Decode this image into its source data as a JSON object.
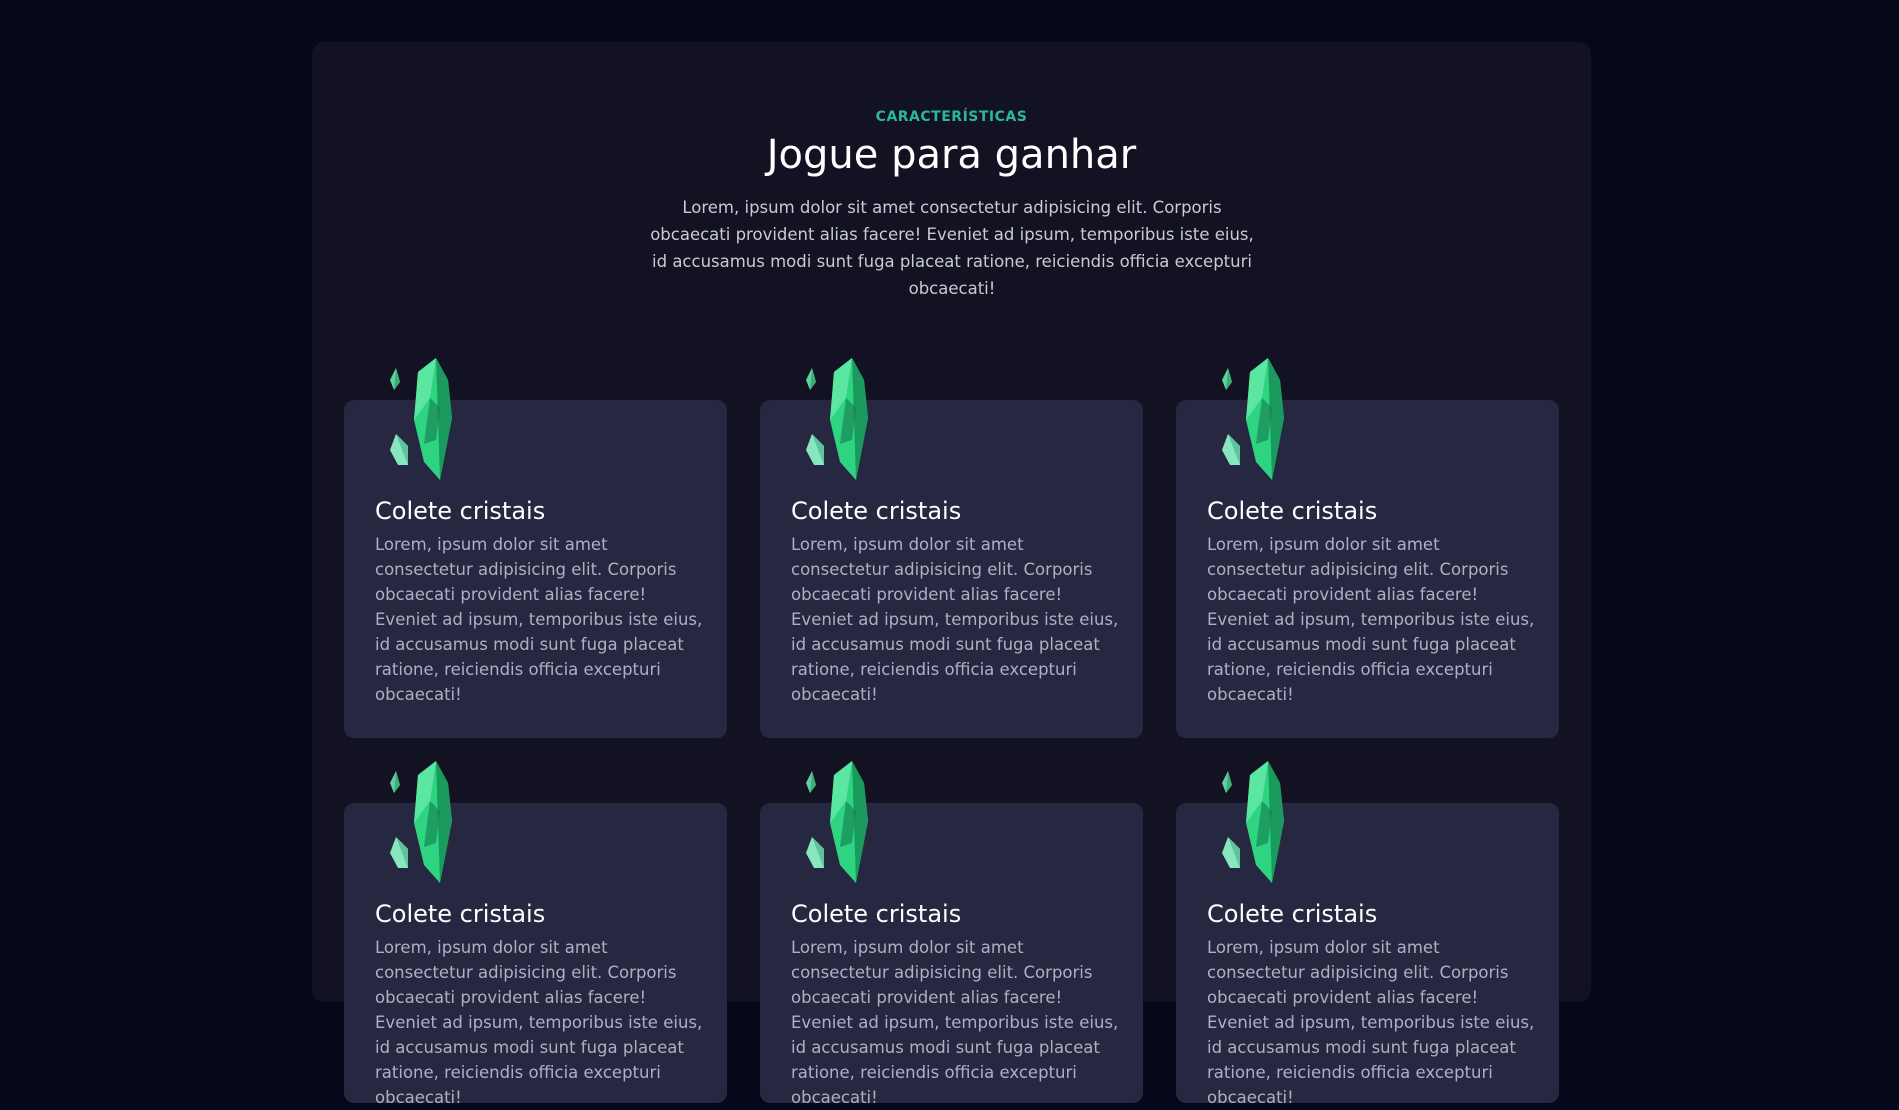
{
  "section": {
    "eyebrow": "CARACTERÍSTICAS",
    "title": "Jogue para ganhar",
    "intro": "Lorem, ipsum dolor sit amet consectetur adipisicing elit. Corporis obcaecati provident alias facere! Eveniet ad ipsum, temporibus iste eius, id accusamus modi sunt fuga placeat ratione, reiciendis officia excepturi obcaecati!"
  },
  "features": [
    {
      "title": "Colete cristais",
      "text": "Lorem, ipsum dolor sit amet consectetur adipisicing elit. Corporis obcaecati provident alias facere! Eveniet ad ipsum, temporibus iste eius, id accusamus modi sunt fuga placeat ratione, reiciendis officia excepturi obcaecati!",
      "icon": "crystal-icon"
    },
    {
      "title": "Colete cristais",
      "text": "Lorem, ipsum dolor sit amet consectetur adipisicing elit. Corporis obcaecati provident alias facere! Eveniet ad ipsum, temporibus iste eius, id accusamus modi sunt fuga placeat ratione, reiciendis officia excepturi obcaecati!",
      "icon": "crystal-icon"
    },
    {
      "title": "Colete cristais",
      "text": "Lorem, ipsum dolor sit amet consectetur adipisicing elit. Corporis obcaecati provident alias facere! Eveniet ad ipsum, temporibus iste eius, id accusamus modi sunt fuga placeat ratione, reiciendis officia excepturi obcaecati!",
      "icon": "crystal-icon"
    },
    {
      "title": "Colete cristais",
      "text": "Lorem, ipsum dolor sit amet consectetur adipisicing elit. Corporis obcaecati provident alias facere! Eveniet ad ipsum, temporibus iste eius, id accusamus modi sunt fuga placeat ratione, reiciendis officia excepturi obcaecati!",
      "icon": "crystal-icon"
    },
    {
      "title": "Colete cristais",
      "text": "Lorem, ipsum dolor sit amet consectetur adipisicing elit. Corporis obcaecati provident alias facere! Eveniet ad ipsum, temporibus iste eius, id accusamus modi sunt fuga placeat ratione, reiciendis officia excepturi obcaecati!",
      "icon": "crystal-icon"
    },
    {
      "title": "Colete cristais",
      "text": "Lorem, ipsum dolor sit amet consectetur adipisicing elit. Corporis obcaecati provident alias facere! Eveniet ad ipsum, temporibus iste eius, id accusamus modi sunt fuga placeat ratione, reiciendis officia excepturi obcaecati!",
      "icon": "crystal-icon"
    }
  ],
  "colors": {
    "page_background": "#05071a",
    "section_background": "#121222",
    "card_background": "#252840",
    "accent": "#2bb79a",
    "crystal": "#2ed482"
  }
}
